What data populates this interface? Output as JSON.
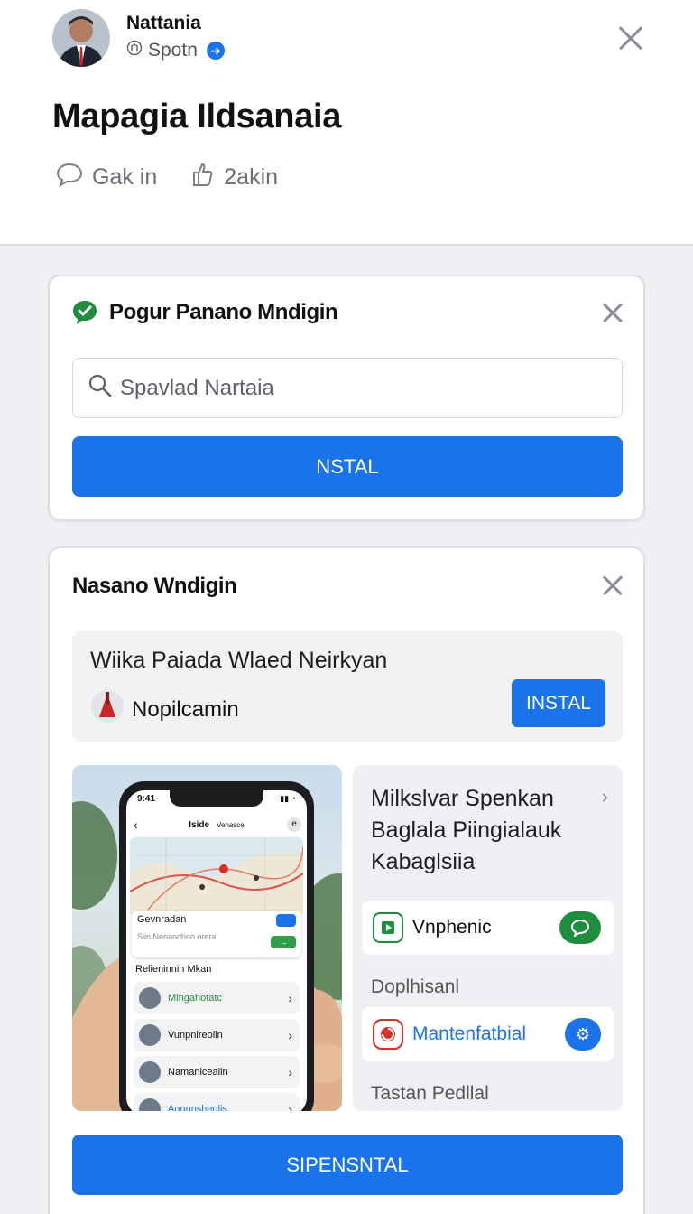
{
  "header": {
    "author_name": "Nattania",
    "author_sub": "Spotn",
    "title": "Mapagia Ildsanaia",
    "actions": [
      {
        "icon": "comment-icon",
        "label": "Gak in"
      },
      {
        "icon": "like-icon",
        "label": "2akin"
      }
    ]
  },
  "card1": {
    "title": "Pogur Panano Mndigin",
    "search_placeholder": "Spavlad Nartaia",
    "button_label": "NSTAL"
  },
  "card2": {
    "title": "Nasano Wndigin",
    "promo": {
      "title": "Wiika Paiada Wlaed Neirkyan",
      "app_name": "Nopilcamin",
      "button_label": "INSTAL"
    },
    "phone": {
      "time": "9:41",
      "nav_left": "Iside",
      "nav_right": "Venasce",
      "card_title": "Gevnradan",
      "card_sub": "Siin Nenandhno orera",
      "list_header": "Relieninnin Mkan",
      "list": [
        "Mingahotatc",
        "Vunpnlreolin",
        "Namanlcealin",
        "Agnnnsheglis"
      ]
    },
    "panel": {
      "title": "Milkslvar Spenkan Baglala Piingialauk Kabaglsiia",
      "row1": "Vnphenic",
      "label1": "Doplhisanl",
      "row2": "Mantenfatbial",
      "label2": "Tastan Pedllal"
    },
    "bottom_button": "SIPENSNTAL"
  },
  "colors": {
    "accent": "#1a73e8",
    "green": "#1e8e3e",
    "red": "#d93025",
    "background": "#eef0f3"
  }
}
